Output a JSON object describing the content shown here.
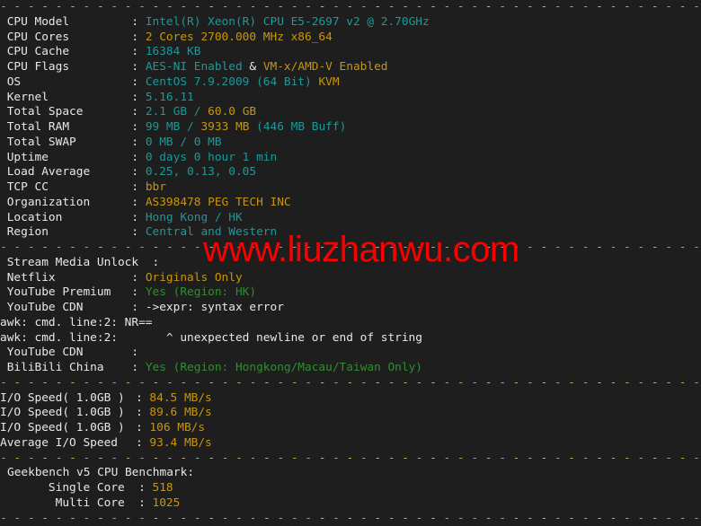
{
  "terminal": {
    "background_color": "#1e1e1e",
    "label_color": "#e8e8e8",
    "teal_color": "#1a9a9a",
    "yellow_color": "#c8960c",
    "green_color": "#2f8f2f",
    "watermark_color": "#ff0000",
    "separator_glyph": "-"
  },
  "watermark": {
    "text": "www.liuzhanwu.com"
  },
  "system_info": {
    "rows": [
      {
        "label": "CPU Model",
        "sep": ":",
        "value": "Intel(R) Xeon(R) CPU E5-2697 v2 @ 2.70GHz"
      },
      {
        "label": "CPU Cores",
        "sep": ":",
        "value": "2 Cores 2700.000 MHz x86_64"
      },
      {
        "label": "CPU Cache",
        "sep": ":",
        "value": "16384 KB"
      },
      {
        "label": "CPU Flags",
        "sep": ":",
        "value": "AES-NI Enabled & VM-x/AMD-V Enabled"
      },
      {
        "label": "OS",
        "sep": ":",
        "value": "CentOS 7.9.2009 (64 Bit) KVM"
      },
      {
        "label": "Kernel",
        "sep": ":",
        "value": "5.16.11"
      },
      {
        "label": "Total Space",
        "sep": ":",
        "value": "2.1 GB / 60.0 GB"
      },
      {
        "label": "Total RAM",
        "sep": ":",
        "value": "99 MB / 3933 MB (446 MB Buff)"
      },
      {
        "label": "Total SWAP",
        "sep": ":",
        "value": "0 MB / 0 MB"
      },
      {
        "label": "Uptime",
        "sep": ":",
        "value": "0 days 0 hour 1 min"
      },
      {
        "label": "Load Average",
        "sep": ":",
        "value": "0.25, 0.13, 0.05"
      },
      {
        "label": "TCP CC",
        "sep": ":",
        "value": "bbr"
      },
      {
        "label": "Organization",
        "sep": ":",
        "value": "AS398478 PEG TECH INC"
      },
      {
        "label": "Location",
        "sep": ":",
        "value": "Hong Kong / HK"
      },
      {
        "label": "Region",
        "sep": ":",
        "value": "Central and Western"
      }
    ],
    "cpu_model": {
      "value": "Intel(R) Xeon(R) CPU E5-2697 v2 @ 2.70GHz"
    },
    "cpu_cores": {
      "value": "2 Cores 2700.000 MHz x86_64"
    },
    "cpu_cache": {
      "value": "16384 KB"
    },
    "cpu_flags": {
      "part1": "AES-NI Enabled",
      "amp": " & ",
      "part2": "VM-x/AMD-V Enabled"
    },
    "os": {
      "part1": "CentOS 7.9.2009 (64 Bit) ",
      "part2": "KVM"
    },
    "kernel": {
      "value": "5.16.11"
    },
    "total_space": {
      "part1": "2.1 GB",
      "slash": " / ",
      "part2": "60.0 GB"
    },
    "total_ram": {
      "part1": "99 MB",
      "slash": " / ",
      "part2": "3933 MB",
      "buff": " (446 MB Buff)"
    },
    "total_swap": {
      "value": "0 MB / 0 MB"
    },
    "uptime": {
      "value": "0 days 0 hour 1 min"
    },
    "load_average": {
      "value": "0.25, 0.13, 0.05"
    },
    "tcp_cc": {
      "value": "bbr"
    },
    "organization": {
      "value": "AS398478 PEG TECH INC"
    },
    "location": {
      "value": "Hong Kong / HK"
    },
    "region": {
      "value": "Central and Western"
    }
  },
  "stream_media": {
    "header_label": "Stream Media Unlock",
    "header_sep": ":",
    "netflix_label": "Netflix",
    "netflix_value": "Originals Only",
    "youtube_premium_label": "YouTube Premium",
    "youtube_premium_value": "Yes (Region: HK)",
    "youtube_cdn_label": "YouTube CDN",
    "youtube_cdn_value": "->expr: syntax error",
    "awk_error_1": "awk: cmd. line:2: NR==",
    "awk_error_2": "awk: cmd. line:2:       ^ unexpected newline or end of string",
    "youtube_cdn_label_2": "YouTube CDN",
    "youtube_cdn_value_2": "",
    "bilibili_label": "BiliBili China",
    "bilibili_value": "Yes (Region: Hongkong/Macau/Taiwan Only)"
  },
  "io_speed": {
    "rows": [
      {
        "label": "I/O Speed( 1.0GB )",
        "value": "84.5 MB/s"
      },
      {
        "label": "I/O Speed( 1.0GB )",
        "value": "89.6 MB/s"
      },
      {
        "label": "I/O Speed( 1.0GB )",
        "value": "106 MB/s"
      },
      {
        "label": "Average I/O Speed",
        "value": "93.4 MB/s"
      }
    ],
    "row1_label": "I/O Speed( 1.0GB )",
    "row1_value": "84.5 MB/s",
    "row2_label": "I/O Speed( 1.0GB )",
    "row2_value": "89.6 MB/s",
    "row3_label": "I/O Speed( 1.0GB )",
    "row3_value": "106 MB/s",
    "row4_label": "Average I/O Speed",
    "row4_value": "93.4 MB/s"
  },
  "geekbench": {
    "title": "Geekbench v5 CPU Benchmark:",
    "single_core_label": "Single Core",
    "single_core_value": "518",
    "multi_core_label": "Multi Core",
    "multi_core_value": "1025"
  }
}
